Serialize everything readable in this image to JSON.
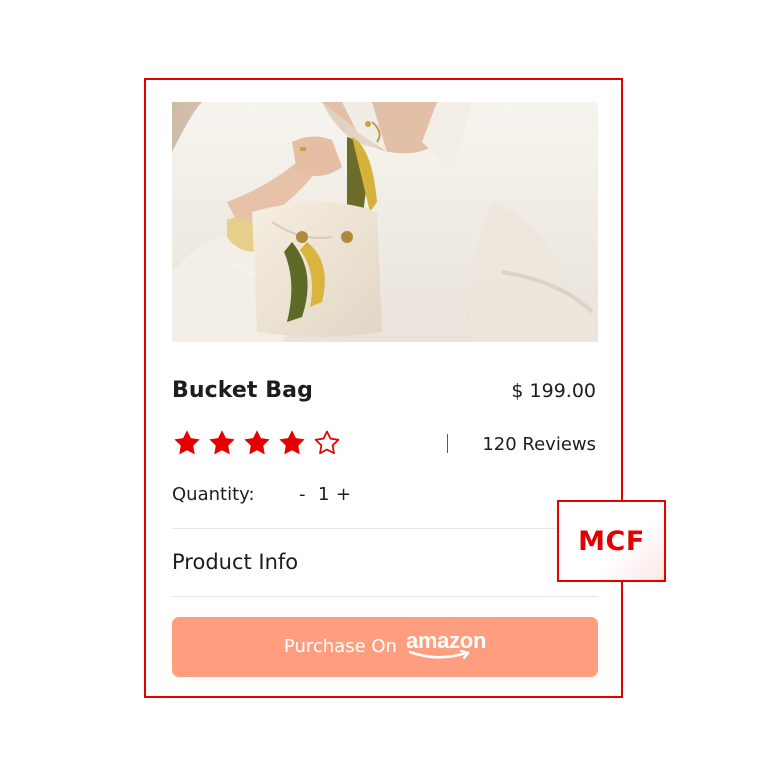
{
  "product": {
    "title": "Bucket Bag",
    "price": "$ 199.00",
    "rating": 4,
    "rating_max": 5,
    "reviews": "120 Reviews",
    "quantity_label": "Quantity:",
    "quantity_minus": "-",
    "quantity_value": "1",
    "quantity_plus": "+",
    "info_label": "Product Info"
  },
  "purchase": {
    "text": "Purchase On",
    "brand": "amazon"
  },
  "badge": {
    "text": "MCF"
  },
  "colors": {
    "accent": "#e40000",
    "button": "#ff9e7e"
  }
}
